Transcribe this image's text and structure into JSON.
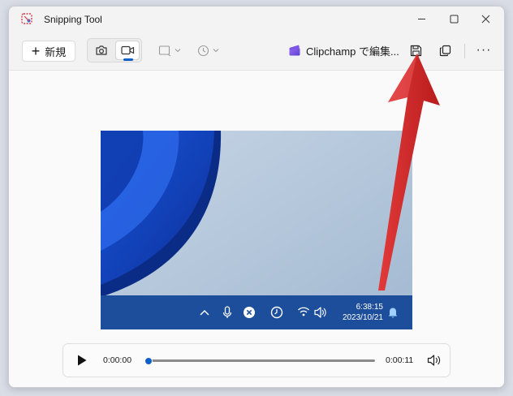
{
  "window": {
    "title": "Snipping Tool"
  },
  "window_controls": {
    "minimize": "—",
    "maximize": "☐",
    "close": "✕"
  },
  "toolbar": {
    "new_label": "新規",
    "clipchamp_label": "Clipchamp で編集...",
    "more_label": "···"
  },
  "taskbar": {
    "time": "6:38:15",
    "date": "2023/10/21"
  },
  "player": {
    "current_time": "0:00:00",
    "end_time": "0:00:11",
    "progress": 0.0
  },
  "colors": {
    "accent": "#0a5fc9",
    "taskbar": "#1d4e9c",
    "annotation_arrow": "#d62a2a"
  }
}
